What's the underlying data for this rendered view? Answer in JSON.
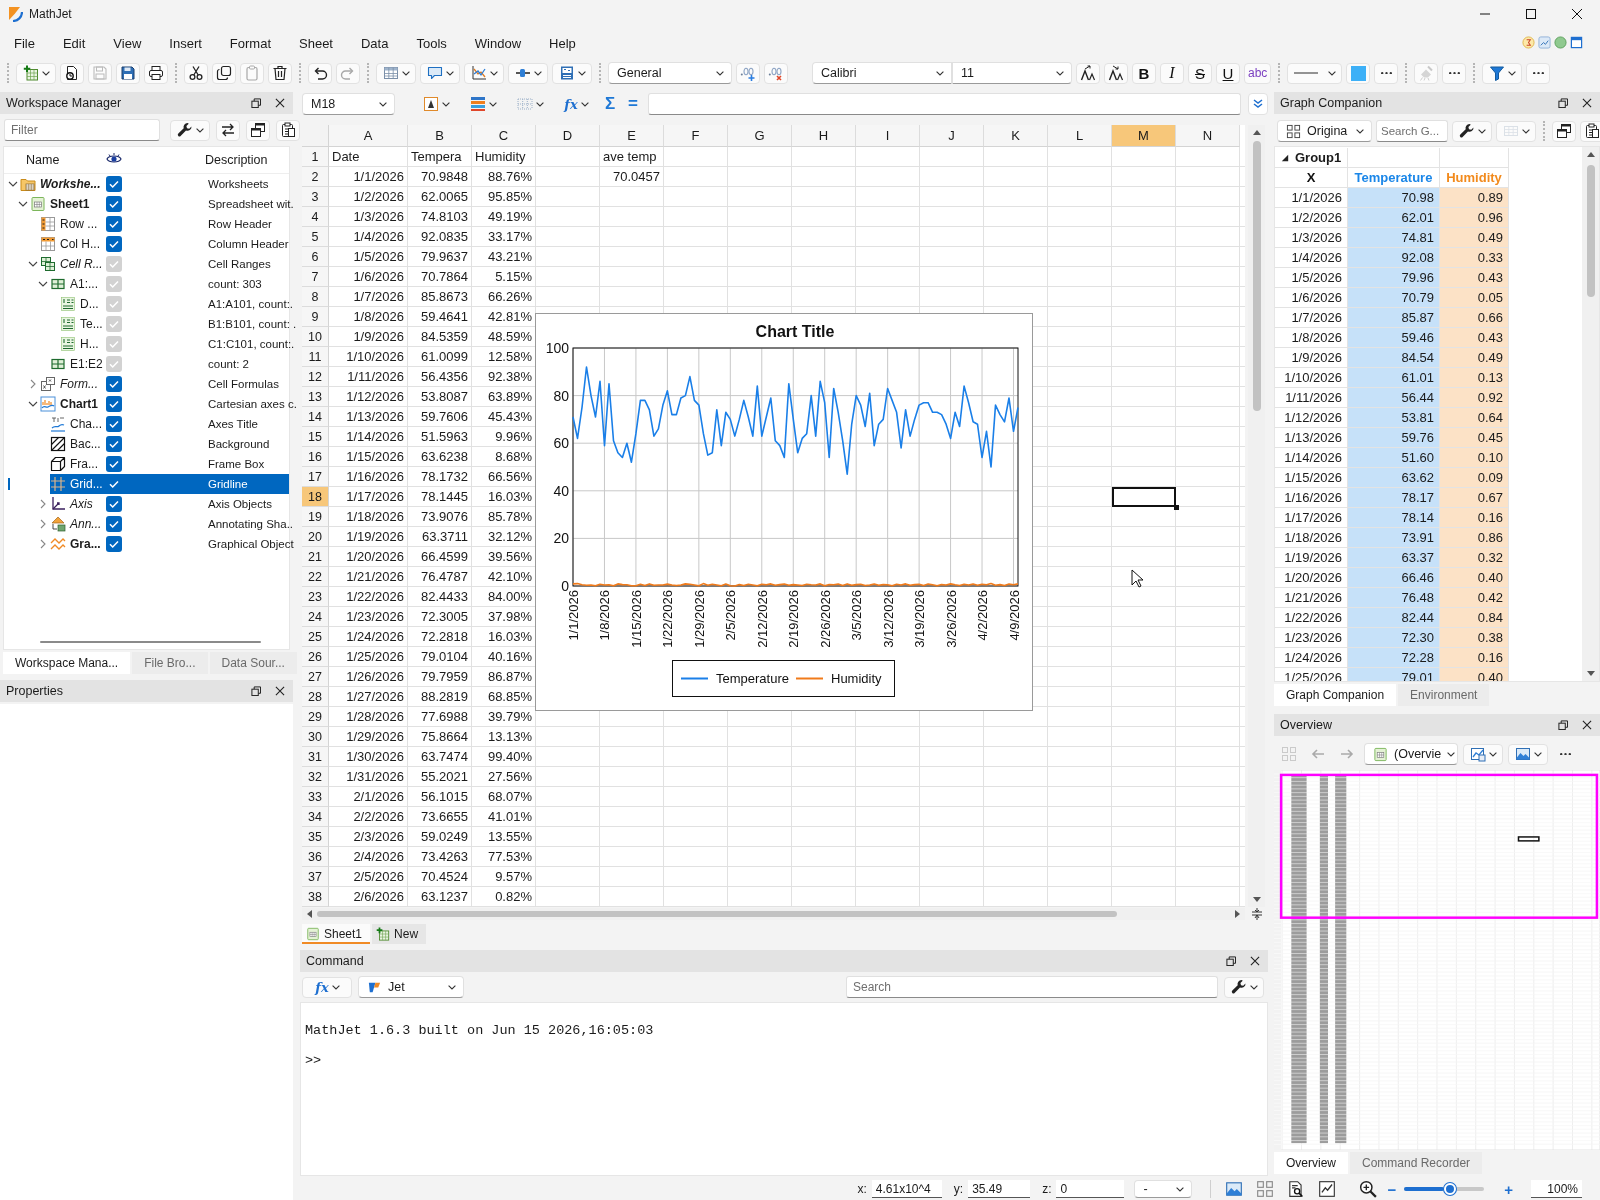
{
  "window": {
    "title": "MathJet"
  },
  "menu": [
    "File",
    "Edit",
    "View",
    "Insert",
    "Format",
    "Sheet",
    "Data",
    "Tools",
    "Window",
    "Help"
  ],
  "toolbar": [
    {
      "kind": "separator"
    },
    {
      "kind": "new",
      "disabled": false
    },
    {
      "kind": "open",
      "disabled": false
    },
    {
      "kind": "save",
      "disabled": true
    },
    {
      "kind": "save-all",
      "disabled": false
    },
    {
      "kind": "print",
      "disabled": false
    },
    {
      "kind": "separator"
    },
    {
      "kind": "cut",
      "disabled": false
    },
    {
      "kind": "copy",
      "disabled": false
    },
    {
      "kind": "paste",
      "disabled": true
    },
    {
      "kind": "delete",
      "disabled": false
    },
    {
      "kind": "separator"
    },
    {
      "kind": "undo",
      "disabled": false
    },
    {
      "kind": "redo",
      "disabled": true
    },
    {
      "kind": "separator"
    },
    {
      "kind": "table",
      "disabled": false
    },
    {
      "kind": "comment",
      "disabled": false
    },
    {
      "kind": "chart",
      "disabled": false
    },
    {
      "kind": "connector",
      "disabled": false
    },
    {
      "kind": "equation",
      "disabled": false
    },
    {
      "kind": "separator"
    },
    {
      "kind": "number-format",
      "value": "General"
    },
    {
      "kind": "add-decimal",
      "disabled": false
    },
    {
      "kind": "remove-decimal",
      "disabled": false
    },
    {
      "kind": "font",
      "value": "Calibri"
    },
    {
      "kind": "font-size",
      "value": "11"
    },
    {
      "kind": "grow-font",
      "disabled": false
    },
    {
      "kind": "shrink-font",
      "disabled": false
    },
    {
      "kind": "bold",
      "label": "B",
      "disabled": false
    },
    {
      "kind": "italic",
      "label": "I",
      "disabled": false
    },
    {
      "kind": "strike",
      "label": "S",
      "disabled": false
    },
    {
      "kind": "underline",
      "label": "U",
      "disabled": false
    },
    {
      "kind": "spelling",
      "label": "abc",
      "disabled": false
    },
    {
      "kind": "separator"
    },
    {
      "kind": "line-style",
      "disabled": false
    },
    {
      "kind": "fill",
      "disabled": false
    },
    {
      "kind": "more",
      "disabled": false
    },
    {
      "kind": "separator"
    },
    {
      "kind": "eraser",
      "disabled": true
    },
    {
      "kind": "more",
      "disabled": false
    },
    {
      "kind": "separator"
    },
    {
      "kind": "filter",
      "disabled": false
    },
    {
      "kind": "more",
      "disabled": false
    }
  ],
  "workspace_manager": {
    "title": "Workspace Manager",
    "tools": [
      {
        "kind": "filter-input",
        "placeholder": "Filter"
      },
      {
        "kind": "wrench",
        "disabled": false
      },
      {
        "kind": "swap",
        "disabled": false
      },
      {
        "kind": "copy-window",
        "disabled": false
      },
      {
        "kind": "paste-window",
        "disabled": false
      }
    ],
    "columns": [
      "Name",
      "Description"
    ],
    "tree": [
      {
        "label": "Workshe...",
        "kind": "workspace",
        "bold": true,
        "italic": true,
        "expanded": true,
        "visible": true,
        "disabled": false,
        "selected": false,
        "description": "Worksheets",
        "children": [
          {
            "label": "Sheet1",
            "kind": "sheet",
            "bold": true,
            "italic": false,
            "expanded": true,
            "visible": true,
            "disabled": false,
            "selected": false,
            "description": "Spreadsheet wit.",
            "children": [
              {
                "label": "Row ...",
                "kind": "row-header",
                "bold": false,
                "italic": false,
                "visible": true,
                "disabled": false,
                "selected": false,
                "description": "Row Header"
              },
              {
                "label": "Col H...",
                "kind": "column-header",
                "bold": false,
                "italic": false,
                "visible": true,
                "disabled": false,
                "selected": false,
                "description": "Column Header"
              },
              {
                "label": "Cell R...",
                "kind": "cell-ranges",
                "bold": false,
                "italic": true,
                "expanded": true,
                "visible": true,
                "disabled": true,
                "selected": false,
                "description": "Cell Ranges",
                "children": [
                  {
                    "label": "A1:...",
                    "kind": "range",
                    "bold": false,
                    "italic": false,
                    "expanded": true,
                    "visible": true,
                    "disabled": true,
                    "selected": false,
                    "description": "count: 303",
                    "children": [
                      {
                        "label": "D...",
                        "kind": "data-range",
                        "bold": false,
                        "italic": false,
                        "visible": true,
                        "disabled": true,
                        "selected": false,
                        "description": "A1:A101, count:."
                      },
                      {
                        "label": "Te...",
                        "kind": "data-range",
                        "bold": false,
                        "italic": false,
                        "visible": true,
                        "disabled": true,
                        "selected": false,
                        "description": "B1:B101, count: ."
                      },
                      {
                        "label": "H...",
                        "kind": "data-range",
                        "bold": false,
                        "italic": false,
                        "visible": true,
                        "disabled": true,
                        "selected": false,
                        "description": "C1:C101, count:."
                      }
                    ]
                  },
                  {
                    "label": "E1:E2",
                    "kind": "range",
                    "bold": false,
                    "italic": false,
                    "visible": true,
                    "disabled": true,
                    "selected": false,
                    "description": "count: 2"
                  }
                ]
              },
              {
                "label": "Form...",
                "kind": "formulas",
                "bold": false,
                "italic": true,
                "expanded": false,
                "visible": true,
                "disabled": false,
                "selected": false,
                "description": "Cell Formulas"
              },
              {
                "label": "Chart1",
                "kind": "chart",
                "bold": true,
                "italic": false,
                "expanded": true,
                "visible": true,
                "disabled": false,
                "selected": false,
                "description": "Cartesian axes c.",
                "children": [
                  {
                    "label": "Cha...",
                    "kind": "title",
                    "bold": false,
                    "italic": false,
                    "visible": true,
                    "disabled": false,
                    "selected": false,
                    "description": "Axes Title"
                  },
                  {
                    "label": "Bac...",
                    "kind": "background",
                    "bold": false,
                    "italic": false,
                    "visible": true,
                    "disabled": false,
                    "selected": false,
                    "description": "Background"
                  },
                  {
                    "label": "Fra...",
                    "kind": "frame",
                    "bold": false,
                    "italic": false,
                    "visible": true,
                    "disabled": false,
                    "selected": false,
                    "description": "Frame Box"
                  },
                  {
                    "label": "Grid...",
                    "kind": "gridline",
                    "bold": false,
                    "italic": false,
                    "visible": true,
                    "disabled": false,
                    "selected": true,
                    "description": "Gridline"
                  },
                  {
                    "label": "Axis",
                    "kind": "axis",
                    "bold": false,
                    "italic": true,
                    "expanded": false,
                    "visible": true,
                    "disabled": false,
                    "selected": false,
                    "description": "Axis Objects"
                  },
                  {
                    "label": "Ann...",
                    "kind": "annotation",
                    "bold": false,
                    "italic": true,
                    "expanded": false,
                    "visible": true,
                    "disabled": false,
                    "selected": false,
                    "description": "Annotating Sha.."
                  },
                  {
                    "label": "Gra...",
                    "kind": "graphics",
                    "bold": true,
                    "italic": false,
                    "expanded": false,
                    "visible": true,
                    "disabled": false,
                    "selected": false,
                    "description": "Graphical Object"
                  }
                ]
              }
            ]
          }
        ]
      }
    ],
    "tabs": [
      {
        "label": "Workspace Mana...",
        "selected": true
      },
      {
        "label": "File Bro...",
        "selected": false
      },
      {
        "label": "Data Sour...",
        "selected": false
      }
    ]
  },
  "properties": {
    "title": "Properties"
  },
  "formula_bar": {
    "tools": [
      {
        "kind": "name-box",
        "value": "M18"
      },
      {
        "kind": "text-color",
        "disabled": false
      },
      {
        "kind": "fill-color",
        "disabled": false
      },
      {
        "kind": "borders",
        "disabled": false
      },
      {
        "kind": "function",
        "label": "fx",
        "disabled": false
      },
      {
        "kind": "sum",
        "label": "Σ",
        "disabled": false
      },
      {
        "kind": "equals",
        "label": "=",
        "disabled": false
      }
    ]
  },
  "sheet": {
    "columns": [
      {
        "label": "A",
        "selected": false
      },
      {
        "label": "B",
        "selected": false
      },
      {
        "label": "C",
        "selected": false
      },
      {
        "label": "D",
        "selected": false
      },
      {
        "label": "E",
        "selected": false
      },
      {
        "label": "F",
        "selected": false
      },
      {
        "label": "G",
        "selected": false
      },
      {
        "label": "H",
        "selected": false
      },
      {
        "label": "I",
        "selected": false
      },
      {
        "label": "J",
        "selected": false
      },
      {
        "label": "K",
        "selected": false
      },
      {
        "label": "L",
        "selected": false
      },
      {
        "label": "M",
        "selected": true
      },
      {
        "label": "N",
        "selected": false
      }
    ],
    "rows": [
      {
        "label": "1",
        "kind": "text",
        "selected": false,
        "cells": [
          "Date",
          "Tempera",
          "Humidity",
          null,
          "ave temp"
        ]
      },
      {
        "label": "2",
        "kind": "number",
        "selected": false,
        "cells": [
          "1/1/2026",
          "70.9848",
          "88.76%",
          null,
          "70.0457"
        ]
      },
      {
        "label": "3",
        "kind": "number",
        "selected": false,
        "cells": [
          "1/2/2026",
          "62.0065",
          "95.85%"
        ]
      },
      {
        "label": "4",
        "kind": "number",
        "selected": false,
        "cells": [
          "1/3/2026",
          "74.8103",
          "49.19%"
        ]
      },
      {
        "label": "5",
        "kind": "number",
        "selected": false,
        "cells": [
          "1/4/2026",
          "92.0835",
          "33.17%"
        ]
      },
      {
        "label": "6",
        "kind": "number",
        "selected": false,
        "cells": [
          "1/5/2026",
          "79.9637",
          "43.21%"
        ]
      },
      {
        "label": "7",
        "kind": "number",
        "selected": false,
        "cells": [
          "1/6/2026",
          "70.7864",
          "5.15%"
        ]
      },
      {
        "label": "8",
        "kind": "number",
        "selected": false,
        "cells": [
          "1/7/2026",
          "85.8673",
          "66.26%"
        ]
      },
      {
        "label": "9",
        "kind": "number",
        "selected": false,
        "cells": [
          "1/8/2026",
          "59.4641",
          "42.81%"
        ]
      },
      {
        "label": "10",
        "kind": "number",
        "selected": false,
        "cells": [
          "1/9/2026",
          "84.5359",
          "48.59%"
        ]
      },
      {
        "label": "11",
        "kind": "number",
        "selected": false,
        "cells": [
          "1/10/2026",
          "61.0099",
          "12.58%"
        ]
      },
      {
        "label": "12",
        "kind": "number",
        "selected": false,
        "cells": [
          "1/11/2026",
          "56.4356",
          "92.38%"
        ]
      },
      {
        "label": "13",
        "kind": "number",
        "selected": false,
        "cells": [
          "1/12/2026",
          "53.8087",
          "63.89%"
        ]
      },
      {
        "label": "14",
        "kind": "number",
        "selected": false,
        "cells": [
          "1/13/2026",
          "59.7606",
          "45.43%"
        ]
      },
      {
        "label": "15",
        "kind": "number",
        "selected": false,
        "cells": [
          "1/14/2026",
          "51.5963",
          "9.96%"
        ]
      },
      {
        "label": "16",
        "kind": "number",
        "selected": false,
        "cells": [
          "1/15/2026",
          "63.6238",
          "8.68%"
        ]
      },
      {
        "label": "17",
        "kind": "number",
        "selected": false,
        "cells": [
          "1/16/2026",
          "78.1732",
          "66.56%"
        ]
      },
      {
        "label": "18",
        "kind": "number",
        "selected": true,
        "cells": [
          "1/17/2026",
          "78.1445",
          "16.03%"
        ]
      },
      {
        "label": "19",
        "kind": "number",
        "selected": false,
        "cells": [
          "1/18/2026",
          "73.9076",
          "85.78%"
        ]
      },
      {
        "label": "20",
        "kind": "number",
        "selected": false,
        "cells": [
          "1/19/2026",
          "63.3711",
          "32.12%"
        ]
      },
      {
        "label": "21",
        "kind": "number",
        "selected": false,
        "cells": [
          "1/20/2026",
          "66.4599",
          "39.56%"
        ]
      },
      {
        "label": "22",
        "kind": "number",
        "selected": false,
        "cells": [
          "1/21/2026",
          "76.4787",
          "42.10%"
        ]
      },
      {
        "label": "23",
        "kind": "number",
        "selected": false,
        "cells": [
          "1/22/2026",
          "82.4433",
          "84.00%"
        ]
      },
      {
        "label": "24",
        "kind": "number",
        "selected": false,
        "cells": [
          "1/23/2026",
          "72.3005",
          "37.98%"
        ]
      },
      {
        "label": "25",
        "kind": "number",
        "selected": false,
        "cells": [
          "1/24/2026",
          "72.2818",
          "16.03%"
        ]
      },
      {
        "label": "26",
        "kind": "number",
        "selected": false,
        "cells": [
          "1/25/2026",
          "79.0104",
          "40.16%"
        ]
      },
      {
        "label": "27",
        "kind": "number",
        "selected": false,
        "cells": [
          "1/26/2026",
          "79.7959",
          "86.87%"
        ]
      },
      {
        "label": "28",
        "kind": "number",
        "selected": false,
        "cells": [
          "1/27/2026",
          "88.2819",
          "68.85%"
        ]
      },
      {
        "label": "29",
        "kind": "number",
        "selected": false,
        "cells": [
          "1/28/2026",
          "77.6988",
          "39.79%"
        ]
      },
      {
        "label": "30",
        "kind": "number",
        "selected": false,
        "cells": [
          "1/29/2026",
          "75.8664",
          "13.13%"
        ]
      },
      {
        "label": "31",
        "kind": "number",
        "selected": false,
        "cells": [
          "1/30/2026",
          "63.7474",
          "99.40%"
        ]
      },
      {
        "label": "32",
        "kind": "number",
        "selected": false,
        "cells": [
          "1/31/2026",
          "55.2021",
          "27.56%"
        ]
      },
      {
        "label": "33",
        "kind": "number",
        "selected": false,
        "cells": [
          "2/1/2026",
          "56.1015",
          "68.07%"
        ]
      },
      {
        "label": "34",
        "kind": "number",
        "selected": false,
        "cells": [
          "2/2/2026",
          "73.6655",
          "41.01%"
        ]
      },
      {
        "label": "35",
        "kind": "number",
        "selected": false,
        "cells": [
          "2/3/2026",
          "59.0249",
          "13.55%"
        ]
      },
      {
        "label": "36",
        "kind": "number",
        "selected": false,
        "cells": [
          "2/4/2026",
          "73.4263",
          "77.53%"
        ]
      },
      {
        "label": "37",
        "kind": "number",
        "selected": false,
        "cells": [
          "2/5/2026",
          "70.4524",
          "9.57%"
        ]
      },
      {
        "label": "38",
        "kind": "number",
        "selected": false,
        "cells": [
          "2/6/2026",
          "63.1237",
          "0.82%"
        ]
      }
    ],
    "chart": {
      "chart_data": {
        "type": "line",
        "title": "Chart Title",
        "categories": [
          "1/1/2026",
          null,
          null,
          null,
          null,
          null,
          null,
          "1/8/2026",
          null,
          null,
          null,
          null,
          null,
          null,
          "1/15/2026",
          null,
          null,
          null,
          null,
          null,
          null,
          "1/22/2026",
          null,
          null,
          null,
          null,
          null,
          null,
          "1/29/2026",
          null,
          null,
          null,
          null,
          null,
          null,
          "2/5/2026",
          null,
          null,
          null,
          null,
          null,
          null,
          "2/12/2026",
          null,
          null,
          null,
          null,
          null,
          null,
          "2/19/2026",
          null,
          null,
          null,
          null,
          null,
          null,
          "2/26/2026",
          null,
          null,
          null,
          null,
          null,
          null,
          "3/5/2026",
          null,
          null,
          null,
          null,
          null,
          null,
          "3/12/2026",
          null,
          null,
          null,
          null,
          null,
          null,
          "3/19/2026",
          null,
          null,
          null,
          null,
          null,
          null,
          "3/26/2026",
          null,
          null,
          null,
          null,
          null,
          null,
          "4/2/2026",
          null,
          null,
          null,
          null,
          null,
          null,
          "4/9/2026",
          null
        ],
        "series": [
          {
            "name": "Temperature",
            "color": "#1a7fe8",
            "values": [
              71,
              62,
              75,
              92,
              80,
              71,
              86,
              59,
              85,
              61,
              56,
              54,
              60,
              52,
              64,
              78,
              78,
              74,
              63,
              66,
              76,
              82,
              72,
              72,
              79,
              80,
              88,
              78,
              76,
              64,
              55,
              56,
              74,
              59,
              73,
              70,
              63,
              70,
              78,
              71,
              63,
              84,
              63,
              71,
              79,
              61,
              59,
              54,
              85,
              70,
              56,
              62,
              64,
              80,
              63,
              86,
              77,
              54,
              83,
              73,
              61,
              47,
              68,
              80,
              76,
              67,
              81,
              59,
              68,
              70,
              83,
              78,
              73,
              58,
              74,
              63,
              70,
              76,
              77,
              77,
              73,
              73,
              72,
              68,
              62,
              73,
              67,
              84,
              77,
              69,
              68,
              54,
              65,
              50,
              76,
              72,
              69,
              79,
              65,
              75
            ]
          },
          {
            "name": "Humidity",
            "color": "#f07a1a",
            "values": [
              0.9,
              1,
              0.5,
              0.3,
              0.4,
              0.1,
              0.7,
              0.4,
              0.5,
              0.1,
              0.9,
              0.6,
              0.5,
              0.1,
              0.1,
              0.7,
              0.2,
              0.9,
              0.3,
              0.4,
              0.4,
              0.8,
              0.4,
              0.2,
              0.4,
              0.9,
              0.7,
              0.4,
              0.1,
              1,
              0.3,
              0.7,
              0.4,
              0.1,
              0.8,
              0.1,
              0,
              0.6,
              0.2,
              0.7,
              0.4,
              0.1,
              0.7,
              0.5,
              0.9,
              0.3,
              0.6,
              0.8,
              0.3,
              0.6,
              0.4,
              0.2,
              0.7,
              0.5,
              0.4,
              0.9,
              0.1,
              0.6,
              0.5,
              0.8,
              0.2,
              0.9,
              0.3,
              0.6,
              0.7,
              0.2,
              0.4,
              0.8,
              0.3,
              0.6,
              0.5,
              0.1,
              0.7,
              0.4,
              0.9,
              0.3,
              0.6,
              0.7,
              0.2,
              0.8,
              0.5,
              0.1,
              0.6,
              0.4,
              0.9,
              0.5,
              0.2,
              0.7,
              0.4,
              0.8,
              0.3,
              0.7,
              0.5,
              1,
              0.3,
              0.6,
              0.2,
              0.8,
              0.5,
              0.9
            ]
          }
        ],
        "ylim": [
          0,
          100
        ],
        "yticks": [
          0,
          20,
          40,
          60,
          80,
          100
        ],
        "grid": true,
        "legend": "bottom"
      }
    },
    "tabs": [
      {
        "label": "Sheet1",
        "kind": "sheet",
        "selected": true
      },
      {
        "label": "New",
        "kind": "add",
        "selected": false
      }
    ]
  },
  "command": {
    "title": "Command",
    "tools": [
      {
        "kind": "function",
        "label": "fx",
        "disabled": false
      },
      {
        "kind": "language",
        "value": "Jet"
      },
      {
        "kind": "search",
        "placeholder": "Search"
      },
      {
        "kind": "wrench",
        "disabled": false
      }
    ],
    "output": [
      "MathJet 1.6.3 built on Jun 15 2026,16:05:03",
      ">>"
    ]
  },
  "graph_companion": {
    "title": "Graph Companion",
    "tools": [
      {
        "kind": "group-view",
        "value": "Origina"
      },
      {
        "kind": "search",
        "placeholder": "Search G..."
      },
      {
        "kind": "wrench",
        "disabled": false
      },
      {
        "kind": "grid-view",
        "disabled": true
      },
      {
        "kind": "separator"
      },
      {
        "kind": "copy-window",
        "disabled": false
      },
      {
        "kind": "paste-window",
        "disabled": false
      }
    ],
    "group": {
      "name": "Group1",
      "expanded": true
    },
    "columns": [
      {
        "label": "X"
      },
      {
        "label": "Temperature",
        "color": "#1a86e8"
      },
      {
        "label": "Humidity",
        "color": "#f28a1c"
      }
    ],
    "rows": [
      [
        "1/1/2026",
        "70.98",
        "0.89"
      ],
      [
        "1/2/2026",
        "62.01",
        "0.96"
      ],
      [
        "1/3/2026",
        "74.81",
        "0.49"
      ],
      [
        "1/4/2026",
        "92.08",
        "0.33"
      ],
      [
        "1/5/2026",
        "79.96",
        "0.43"
      ],
      [
        "1/6/2026",
        "70.79",
        "0.05"
      ],
      [
        "1/7/2026",
        "85.87",
        "0.66"
      ],
      [
        "1/8/2026",
        "59.46",
        "0.43"
      ],
      [
        "1/9/2026",
        "84.54",
        "0.49"
      ],
      [
        "1/10/2026",
        "61.01",
        "0.13"
      ],
      [
        "1/11/2026",
        "56.44",
        "0.92"
      ],
      [
        "1/12/2026",
        "53.81",
        "0.64"
      ],
      [
        "1/13/2026",
        "59.76",
        "0.45"
      ],
      [
        "1/14/2026",
        "51.60",
        "0.10"
      ],
      [
        "1/15/2026",
        "63.62",
        "0.09"
      ],
      [
        "1/16/2026",
        "78.17",
        "0.67"
      ],
      [
        "1/17/2026",
        "78.14",
        "0.16"
      ],
      [
        "1/18/2026",
        "73.91",
        "0.86"
      ],
      [
        "1/19/2026",
        "63.37",
        "0.32"
      ],
      [
        "1/20/2026",
        "66.46",
        "0.40"
      ],
      [
        "1/21/2026",
        "76.48",
        "0.42"
      ],
      [
        "1/22/2026",
        "82.44",
        "0.84"
      ],
      [
        "1/23/2026",
        "72.30",
        "0.38"
      ],
      [
        "1/24/2026",
        "72.28",
        "0.16"
      ],
      [
        "1/25/2026",
        "79.01",
        "0.40"
      ]
    ],
    "tabs": [
      {
        "label": "Graph Companion",
        "selected": true
      },
      {
        "label": "Environment",
        "selected": false
      }
    ]
  },
  "overview": {
    "title": "Overview",
    "tools": [
      {
        "kind": "fit",
        "disabled": true
      },
      {
        "kind": "back",
        "disabled": true
      },
      {
        "kind": "forward",
        "disabled": true
      },
      {
        "kind": "sheet-view",
        "value": "(Overvie"
      },
      {
        "kind": "chart-view",
        "disabled": false
      },
      {
        "kind": "image-view",
        "disabled": false
      },
      {
        "kind": "more",
        "disabled": false
      }
    ],
    "tabs": [
      {
        "label": "Overview",
        "selected": true
      },
      {
        "label": "Command Recorder",
        "selected": false
      }
    ]
  },
  "status_bar": {
    "coords": [
      {
        "label": "x:",
        "value": "4.61x10^4"
      },
      {
        "label": "y:",
        "value": "35.49"
      },
      {
        "label": "z:",
        "value": "0"
      }
    ],
    "mode": "-",
    "zoom": {
      "minus": "−",
      "plus": "+",
      "level": 0.5,
      "value": "100%"
    }
  }
}
